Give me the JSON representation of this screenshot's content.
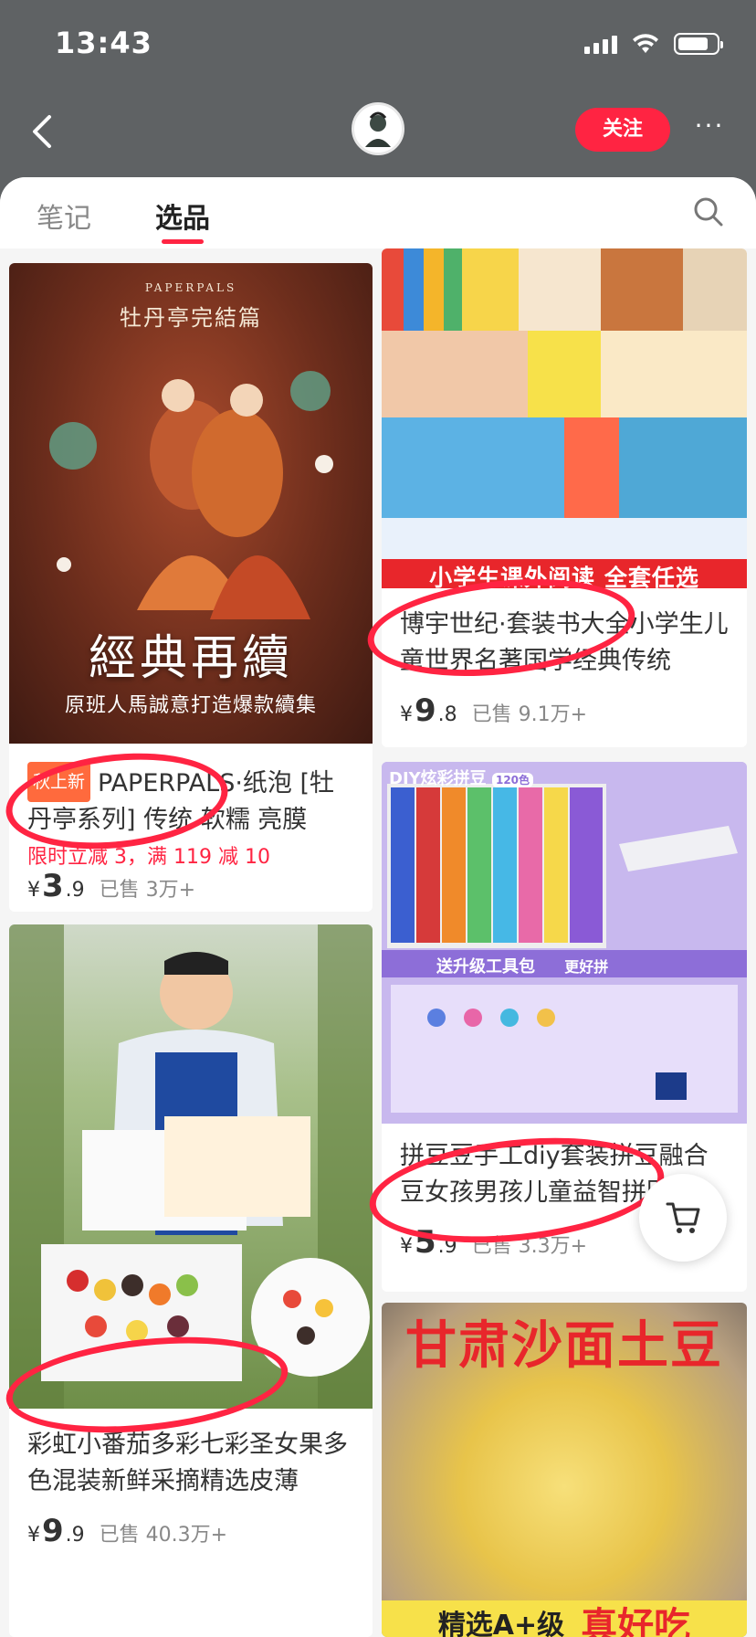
{
  "status": {
    "time": "13:43",
    "battery_level": 0.8
  },
  "header": {
    "follow_label": "关注",
    "more_label": "···"
  },
  "tabs": [
    {
      "label": "笔记",
      "active": false
    },
    {
      "label": "选品",
      "active": true
    }
  ],
  "products": [
    {
      "image_lines": [
        "PAPERPALS",
        "牡丹亭完結篇",
        "經典再續",
        "原班人馬誠意打造爆款續集"
      ],
      "tag": "秋上新",
      "title": "PAPERPALS·纸泡 [牡丹亭系列] 传统 软糯 亮膜",
      "promo": "限时立减 3，满 119 减 10",
      "price_yen": "¥",
      "price_int": "3",
      "price_dec": ".9",
      "sold": "已售 3万+"
    },
    {
      "image_lines": [
        "小学生课外阅读 全套任选"
      ],
      "title": "博宇世纪·套装书大全小学生儿童世界名著国学经典传统",
      "price_yen": "¥",
      "price_int": "9",
      "price_dec": ".8",
      "sold": "已售 9.1万+"
    },
    {
      "image_lines": [
        "DIY炫彩拼豆",
        "120色",
        "送升级工具包",
        "更好拼"
      ],
      "title": "拼豆豆手工diy套装拼豆融合豆女孩男孩儿童益智拼图玩",
      "price_yen": "¥",
      "price_int": "5",
      "price_dec": ".9",
      "sold": "已售 3.3万+"
    },
    {
      "image_lines": [],
      "title": "彩虹小番茄多彩七彩圣女果多色混装新鲜采摘精选皮薄",
      "price_yen": "¥",
      "price_int": "9",
      "price_dec": ".9",
      "sold": "已售 40.3万+"
    },
    {
      "image_lines": [
        "甘肃沙面土豆",
        "精选A+级",
        "真好吃"
      ]
    }
  ],
  "colors": {
    "accent": "#ff2442",
    "header_bg": "#5f6264"
  }
}
